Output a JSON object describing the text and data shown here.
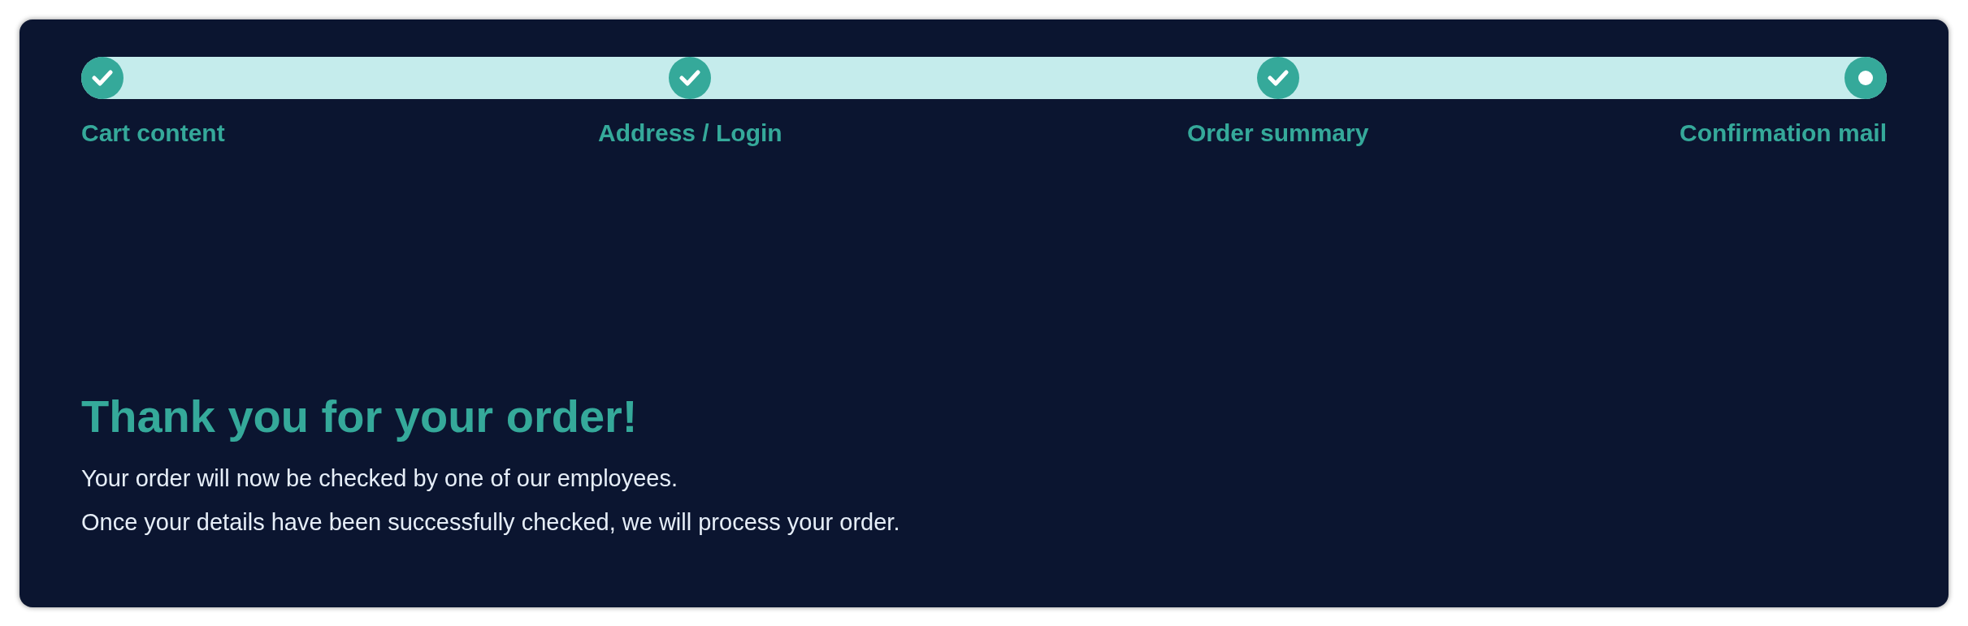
{
  "steps": [
    {
      "label": "Cart content",
      "completed": true
    },
    {
      "label": "Address / Login",
      "completed": true
    },
    {
      "label": "Order summary",
      "completed": true
    },
    {
      "label": "Confirmation mail",
      "completed": false
    }
  ],
  "confirmation": {
    "heading": "Thank you for your order!",
    "lines": [
      "Your order will now be checked by one of our employees.",
      "Once your details have been successfully checked, we will process your order."
    ]
  }
}
